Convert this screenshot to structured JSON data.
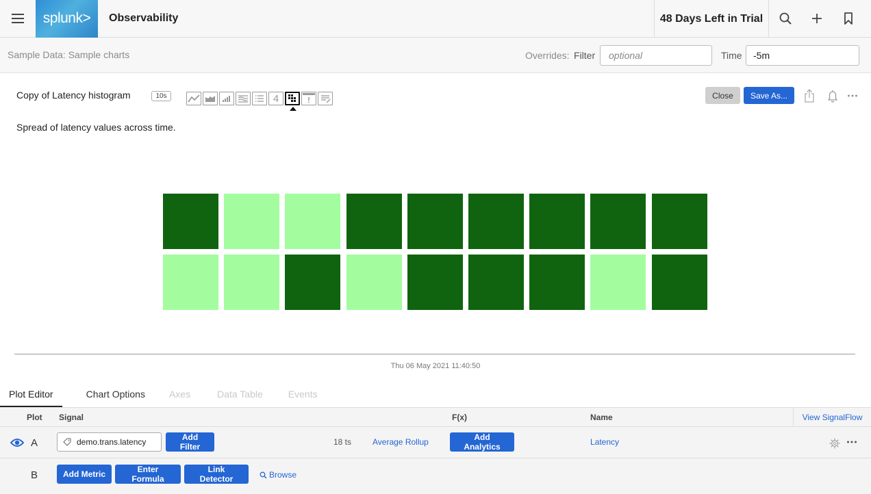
{
  "header": {
    "logo_text": "splunk>",
    "app_title": "Observability",
    "trial_text": "48 Days Left in Trial",
    "icons": [
      "search-icon",
      "plus-icon",
      "bookmark-icon"
    ]
  },
  "subheader": {
    "breadcrumb": "Sample Data: Sample charts",
    "overrides_label": "Overrides:",
    "filter_label": "Filter",
    "filter_placeholder": "optional",
    "filter_value": "",
    "time_label": "Time",
    "time_value": "-5m"
  },
  "chart": {
    "title": "Copy of Latency histogram",
    "resolution_badge": "10s",
    "description": "Spread of latency values across time.",
    "chart_types": [
      {
        "name": "line-chart-icon",
        "active": false
      },
      {
        "name": "area-chart-icon",
        "active": false
      },
      {
        "name": "column-chart-icon",
        "active": false
      },
      {
        "name": "histogram-chart-icon",
        "active": false
      },
      {
        "name": "list-chart-icon",
        "active": false
      },
      {
        "name": "single-value-icon",
        "label": "4",
        "active": false
      },
      {
        "name": "heatmap-chart-icon",
        "active": true
      },
      {
        "name": "event-feed-icon",
        "active": false
      },
      {
        "name": "text-chart-icon",
        "active": false
      }
    ],
    "close_label": "Close",
    "save_as_label": "Save As...",
    "timestamp": "Thu 06 May 2021 11:40:50"
  },
  "chart_data": {
    "type": "heatmap",
    "title": "Copy of Latency histogram",
    "subtitle": "Spread of latency values across time.",
    "rows": 2,
    "columns": 9,
    "colors": {
      "high": "#10640f",
      "low": "#a3fd9f"
    },
    "cells": [
      [
        "high",
        "low",
        "low",
        "high",
        "high",
        "high",
        "high",
        "high",
        "high"
      ],
      [
        "low",
        "low",
        "high",
        "low",
        "high",
        "high",
        "high",
        "low",
        "high"
      ]
    ],
    "timestamp": "Thu 06 May 2021 11:40:50"
  },
  "tabs": [
    {
      "label": "Plot Editor",
      "state": "active"
    },
    {
      "label": "Chart Options",
      "state": "normal"
    },
    {
      "label": "Axes",
      "state": "disabled"
    },
    {
      "label": "Data Table",
      "state": "disabled"
    },
    {
      "label": "Events",
      "state": "disabled"
    }
  ],
  "plot_editor": {
    "columns": {
      "plot": "Plot",
      "signal": "Signal",
      "fx": "F(x)",
      "name": "Name"
    },
    "view_signalflow": "View SignalFlow",
    "row_a": {
      "letter": "A",
      "signal": "demo.trans.latency",
      "add_filter": "Add Filter",
      "ts_count": "18 ts",
      "rollup": "Average Rollup",
      "add_analytics": "Add Analytics",
      "name": "Latency"
    },
    "row_b": {
      "letter": "B",
      "add_metric": "Add Metric",
      "enter_formula": "Enter Formula",
      "link_detector": "Link Detector",
      "browse": "Browse"
    }
  },
  "colors": {
    "accent": "#2466d3",
    "heat_high": "#10640f",
    "heat_low": "#a3fd9f"
  }
}
